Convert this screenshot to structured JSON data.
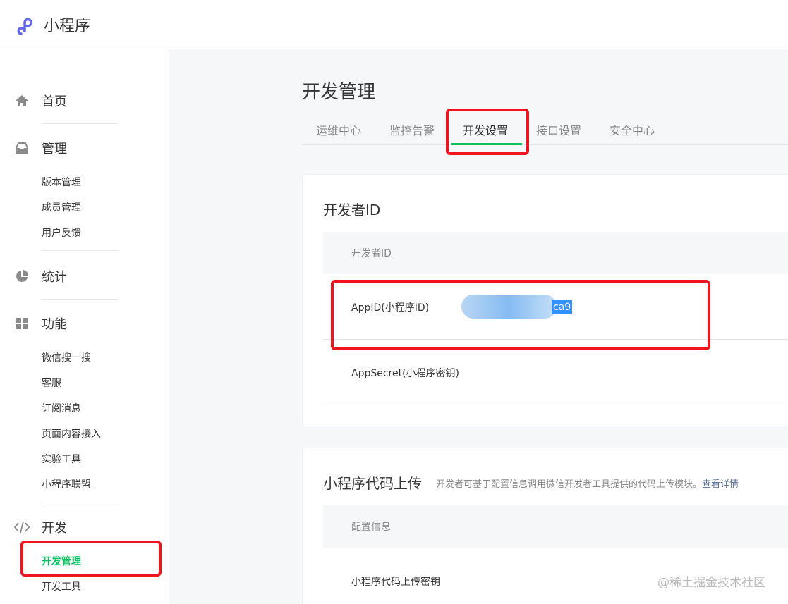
{
  "app": {
    "brand": "小程序",
    "logo_icon": "miniprogram-logo-icon",
    "accent": "#07c160",
    "highlight": "#f0141e"
  },
  "sidebar": {
    "groups": [
      {
        "icon": "home-icon",
        "label": "首页"
      },
      {
        "icon": "inbox-icon",
        "label": "管理"
      },
      {
        "icon": "pie-chart-icon",
        "label": "统计"
      },
      {
        "icon": "grid-icon",
        "label": "功能"
      },
      {
        "icon": "code-icon",
        "label": "开发"
      }
    ],
    "manage_items": [
      "版本管理",
      "成员管理",
      "用户反馈"
    ],
    "feature_items": [
      "微信搜一搜",
      "客服",
      "订阅消息",
      "页面内容接入",
      "实验工具",
      "小程序联盟"
    ],
    "dev_items": [
      "开发管理",
      "开发工具"
    ]
  },
  "main": {
    "title": "开发管理",
    "tabs": [
      "运维中心",
      "监控告警",
      "开发设置",
      "接口设置",
      "安全中心"
    ],
    "active_tab": "开发设置",
    "developer_card": {
      "title": "开发者ID",
      "column_header": "开发者ID",
      "appid_label": "AppID(小程序ID)",
      "appid_visible_tail": "ca9",
      "appsecret_label": "AppSecret(小程序密钥)"
    },
    "upload_card": {
      "title": "小程序代码上传",
      "desc": "开发者可基于配置信息调用微信开发者工具提供的代码上传模块。",
      "link": "查看详情",
      "column_header": "配置信息",
      "key_label": "小程序代码上传密钥"
    }
  },
  "watermark": "@稀土掘金技术社区"
}
